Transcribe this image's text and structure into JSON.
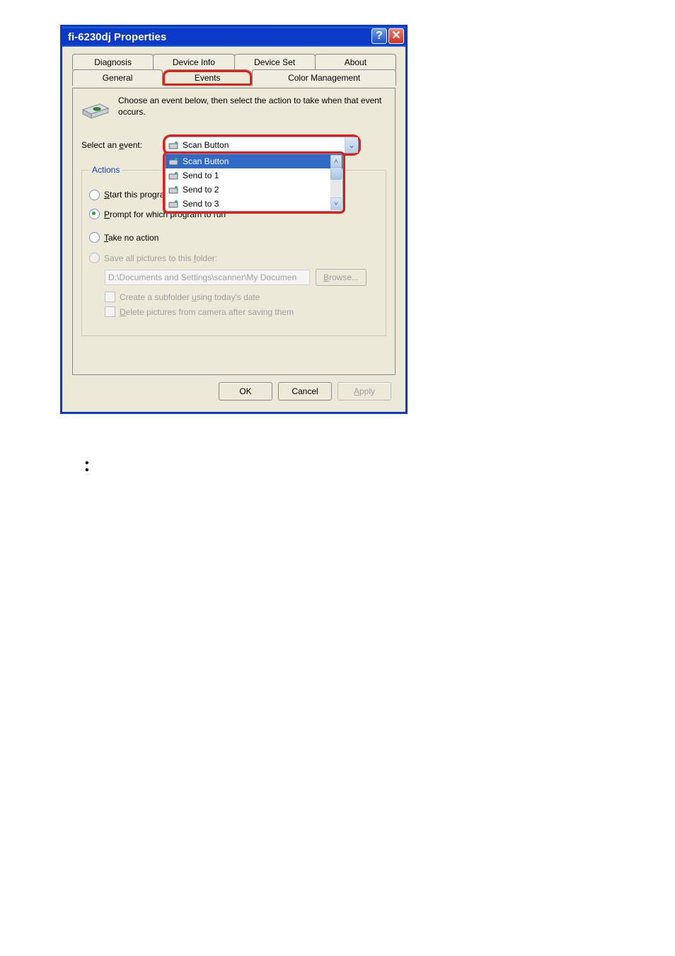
{
  "window": {
    "title": "fi-6230dj Properties"
  },
  "tabs_back": [
    "Diagnosis",
    "Device Info",
    "Device Set",
    "About"
  ],
  "tabs_front": [
    "General",
    "Events",
    "Color Management"
  ],
  "active_tab": "Events",
  "description": "Choose an event below, then select the action to take when that event occurs.",
  "select_event_label_pre": "Select an ",
  "select_event_label_u": "e",
  "select_event_label_post": "vent:",
  "combo_selected": "Scan Button",
  "dropdown": [
    "Scan Button",
    "Send to 1",
    "Send to 2",
    "Send to 3"
  ],
  "actions_legend": "Actions",
  "radio_start_pre": "",
  "radio_start_u": "S",
  "radio_start_post": "tart this program:",
  "radio_prompt_pre": "",
  "radio_prompt_u": "P",
  "radio_prompt_post": "rompt for which program to run",
  "radio_take_pre": "",
  "radio_take_u": "T",
  "radio_take_post": "ake no action",
  "radio_save_pre": "Save all pictures to this ",
  "radio_save_u": "f",
  "radio_save_post": "older:",
  "path_value": "D:\\Documents and Settings\\scanner\\My Documen",
  "browse_pre": "",
  "browse_u": "B",
  "browse_post": "rowse...",
  "chk_subfolder_pre": "Create a subfolder ",
  "chk_subfolder_u": "u",
  "chk_subfolder_post": "sing today's date",
  "chk_delete_pre": "",
  "chk_delete_u": "D",
  "chk_delete_post": "elete pictures from camera after saving them",
  "btn_ok": "OK",
  "btn_cancel": "Cancel",
  "btn_apply_pre": "",
  "btn_apply_u": "A",
  "btn_apply_post": "pply"
}
